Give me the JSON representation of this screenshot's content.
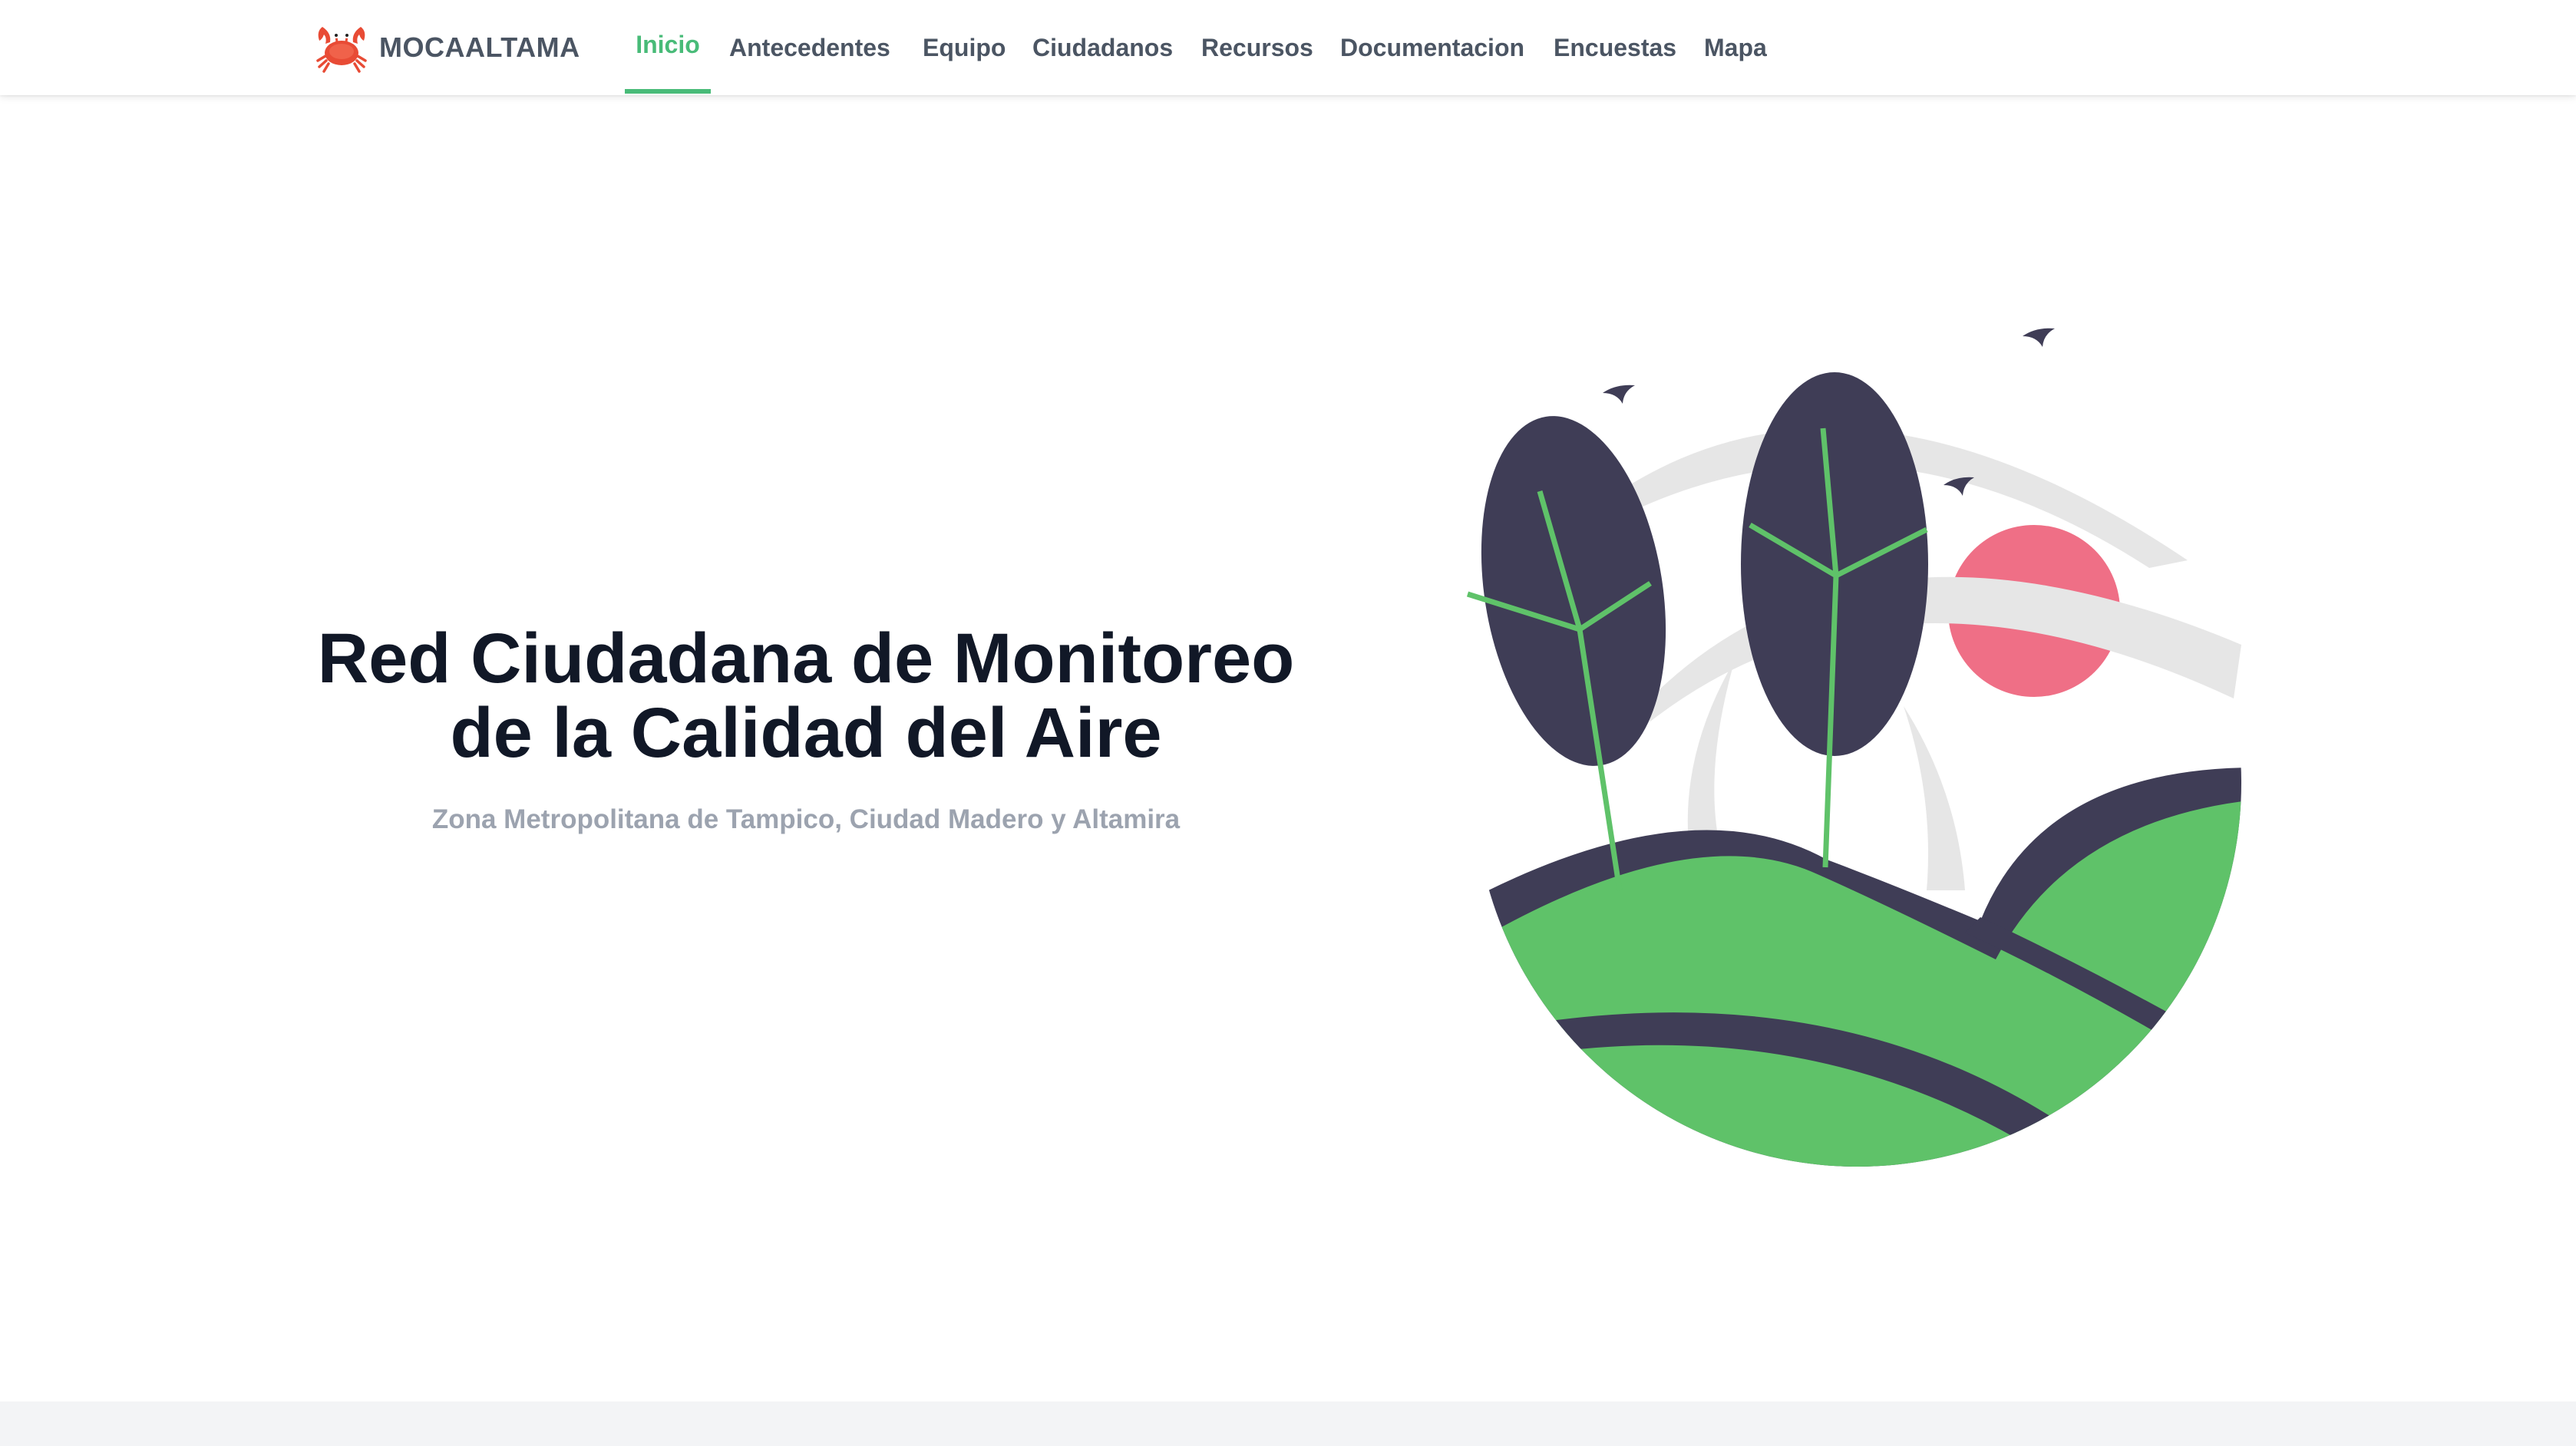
{
  "brand": {
    "name": "MOCAALTAMA",
    "logo_icon": "crab-icon"
  },
  "nav": {
    "items": [
      {
        "label": "Inicio",
        "active": true
      },
      {
        "label": "Antecedentes",
        "active": false
      },
      {
        "label": "Equipo",
        "active": false
      },
      {
        "label": "Ciudadanos",
        "active": false
      },
      {
        "label": "Recursos",
        "active": false
      },
      {
        "label": "Documentacion",
        "active": false
      },
      {
        "label": "Encuestas",
        "active": false
      },
      {
        "label": "Mapa",
        "active": false
      }
    ]
  },
  "hero": {
    "title_line1": "Red Ciudadana de Monitoreo",
    "title_line2": "de la Calidad del Aire",
    "subtitle": "Zona Metropolitana de Tampico, Ciudad Madero y Altamira"
  },
  "colors": {
    "accent": "#48bb78",
    "nav_text": "#4b5563",
    "title": "#111827",
    "subtitle": "#9ca3af",
    "illustration_dark": "#3f3d56",
    "illustration_green": "#5fc269",
    "illustration_sun": "#ef6f86",
    "illustration_arc": "#e6e6e6"
  }
}
